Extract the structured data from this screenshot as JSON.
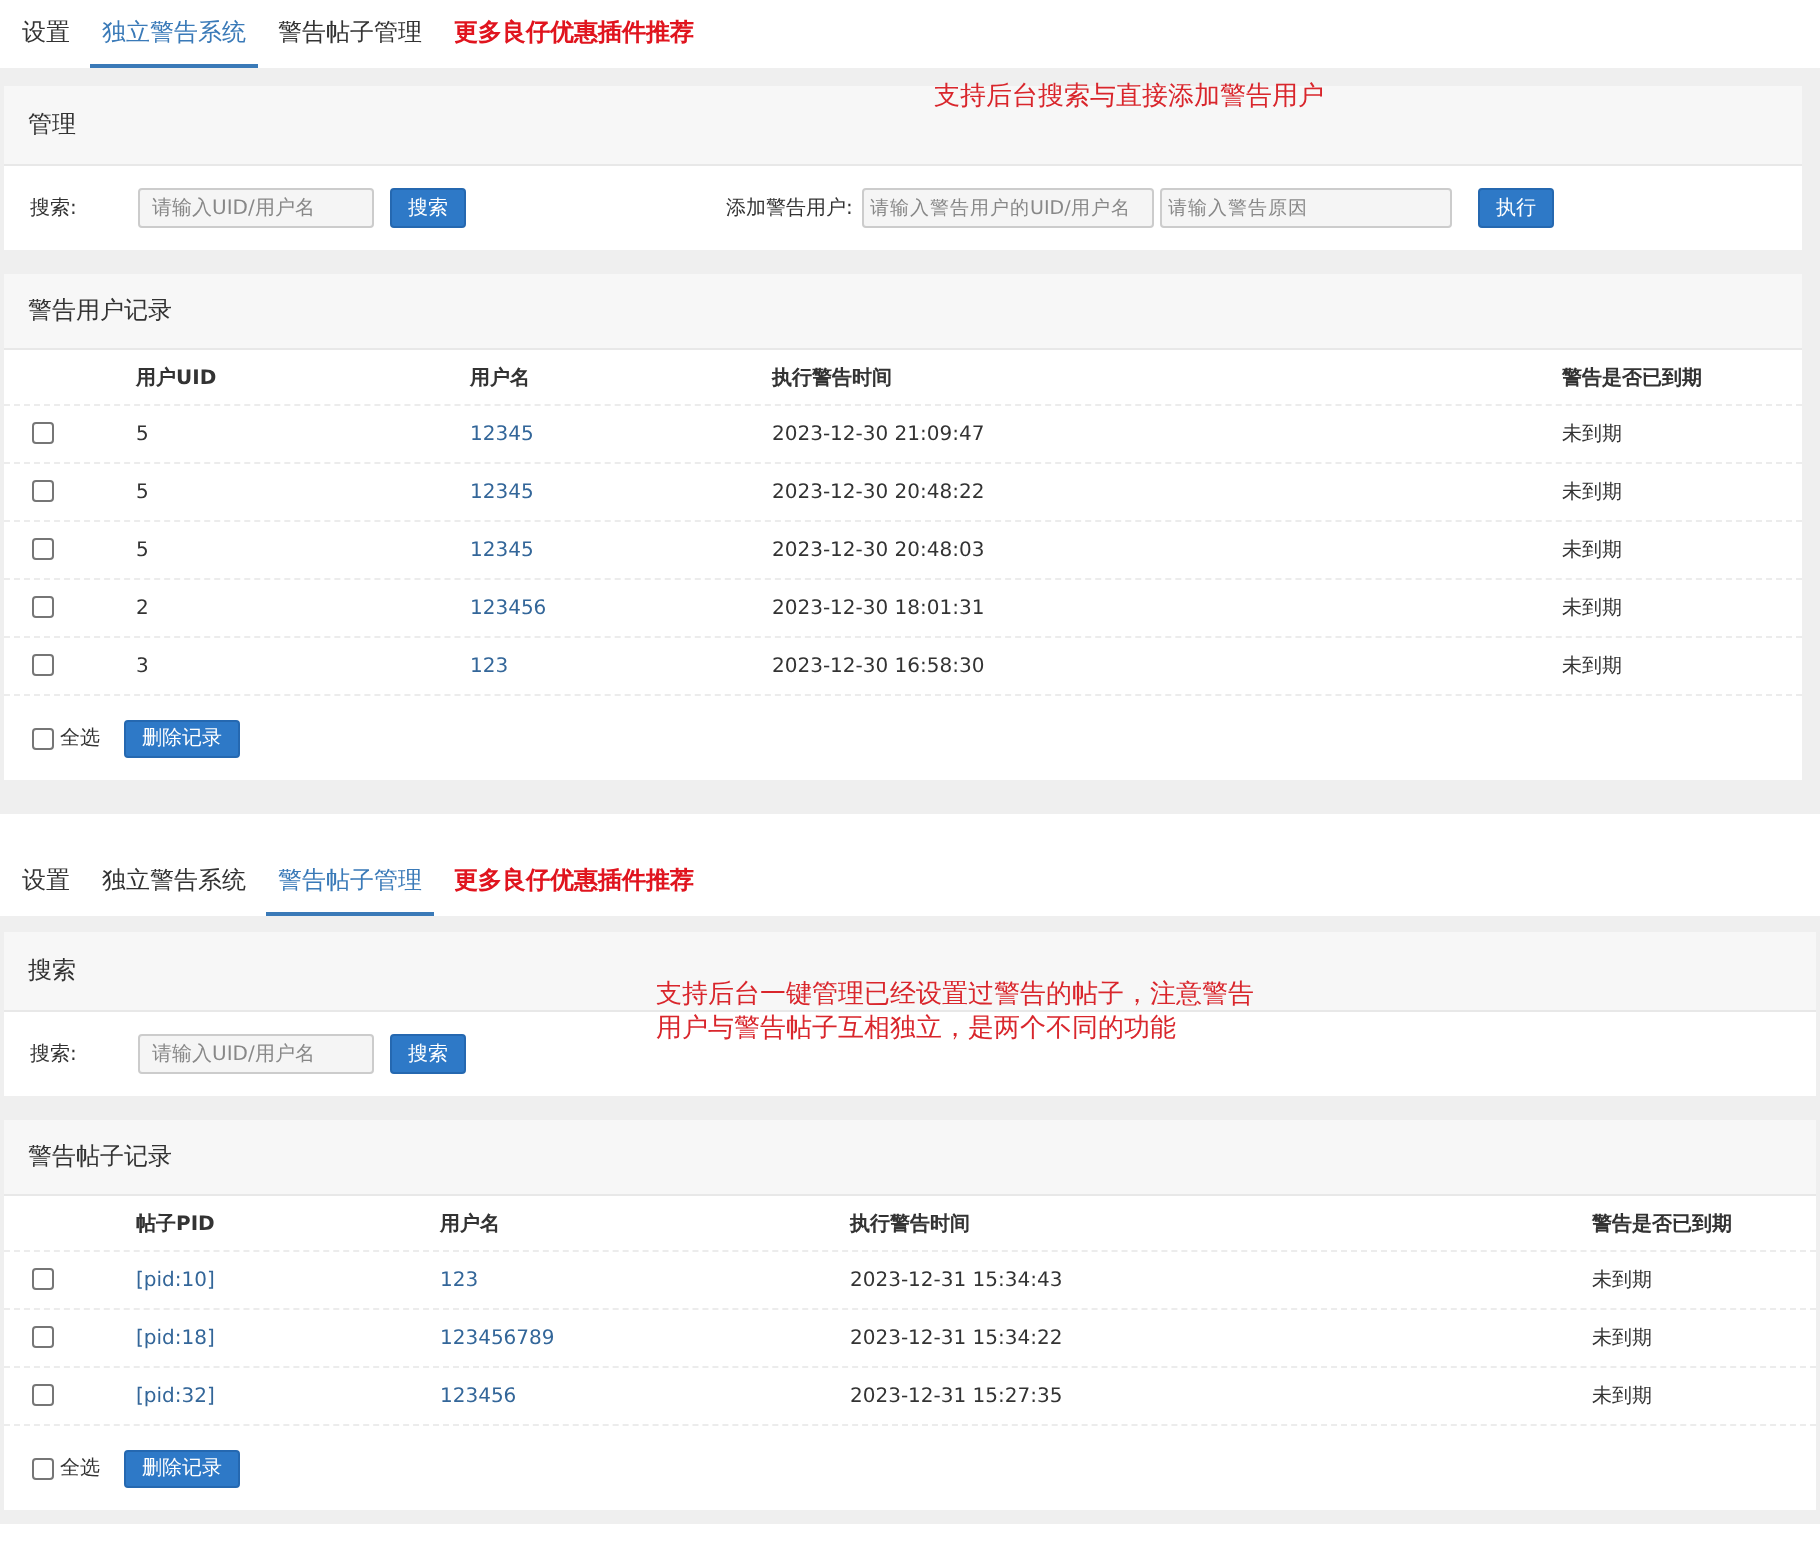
{
  "screens": [
    {
      "tabs": [
        {
          "label": "设置",
          "kind": "link",
          "selected": false
        },
        {
          "label": "独立警告系统",
          "kind": "link",
          "selected": true
        },
        {
          "label": "警告帖子管理",
          "kind": "link",
          "selected": false
        },
        {
          "label": "更多良仔优惠插件推荐",
          "kind": "promo",
          "selected": false
        }
      ],
      "annotation": [
        "支持后台搜索与直接添加警告用户"
      ],
      "search_panel": {
        "title": "管理",
        "search_label": "搜索:",
        "search_placeholder": "请输入UID/用户名",
        "search_button": "搜索",
        "add_label": "添加警告用户:",
        "add_uid_placeholder": "请输入警告用户的UID/用户名",
        "add_reason_placeholder": "请输入警告原因",
        "add_button": "执行"
      },
      "records": {
        "title": "警告用户记录",
        "columns": [
          {
            "label": "用户UID",
            "kind": "text"
          },
          {
            "label": "用户名",
            "kind": "link"
          },
          {
            "label": "执行警告时间",
            "kind": "text"
          },
          {
            "label": "警告是否已到期",
            "kind": "text"
          }
        ],
        "rows": [
          {
            "checked": false,
            "cells": [
              "5",
              "12345",
              "2023-12-30 21:09:47",
              "未到期"
            ]
          },
          {
            "checked": false,
            "cells": [
              "5",
              "12345",
              "2023-12-30 20:48:22",
              "未到期"
            ]
          },
          {
            "checked": false,
            "cells": [
              "5",
              "12345",
              "2023-12-30 20:48:03",
              "未到期"
            ]
          },
          {
            "checked": false,
            "cells": [
              "2",
              "123456",
              "2023-12-30 18:01:31",
              "未到期"
            ]
          },
          {
            "checked": false,
            "cells": [
              "3",
              "123",
              "2023-12-30 16:58:30",
              "未到期"
            ]
          }
        ],
        "select_all": {
          "label": "全选",
          "checked": false
        },
        "delete_button": "删除记录"
      }
    },
    {
      "tabs": [
        {
          "label": "设置",
          "kind": "link",
          "selected": false
        },
        {
          "label": "独立警告系统",
          "kind": "link",
          "selected": false
        },
        {
          "label": "警告帖子管理",
          "kind": "link",
          "selected": true
        },
        {
          "label": "更多良仔优惠插件推荐",
          "kind": "promo",
          "selected": false
        }
      ],
      "annotation": [
        "支持后台一键管理已经设置过警告的帖子，注意警告",
        "用户与警告帖子互相独立，是两个不同的功能"
      ],
      "search_panel": {
        "title": "搜索",
        "search_label": "搜索:",
        "search_placeholder": "请输入UID/用户名",
        "search_button": "搜索"
      },
      "records": {
        "title": "警告帖子记录",
        "columns": [
          {
            "label": "帖子PID",
            "kind": "link"
          },
          {
            "label": "用户名",
            "kind": "link"
          },
          {
            "label": "执行警告时间",
            "kind": "text"
          },
          {
            "label": "警告是否已到期",
            "kind": "text"
          }
        ],
        "rows": [
          {
            "checked": false,
            "cells": [
              "[pid:10]",
              "123",
              "2023-12-31 15:34:43",
              "未到期"
            ]
          },
          {
            "checked": false,
            "cells": [
              "[pid:18]",
              "123456789",
              "2023-12-31 15:34:22",
              "未到期"
            ]
          },
          {
            "checked": false,
            "cells": [
              "[pid:32]",
              "123456",
              "2023-12-31 15:27:35",
              "未到期"
            ]
          }
        ],
        "select_all": {
          "label": "全选",
          "checked": false
        },
        "delete_button": "删除记录"
      }
    }
  ]
}
